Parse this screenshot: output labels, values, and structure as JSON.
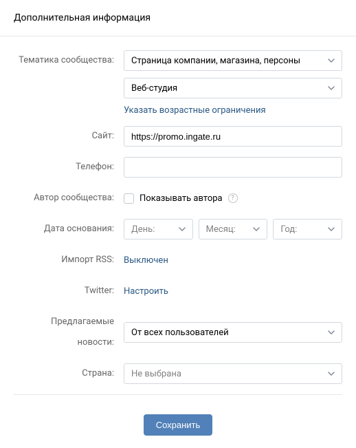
{
  "header": {
    "title": "Дополнительная информация"
  },
  "fields": {
    "topic": {
      "label": "Тематика сообщества:",
      "value": "Страница компании, магазина, персоны",
      "subvalue": "Веб-студия",
      "age_link": "Указать возрастные ограничения"
    },
    "site": {
      "label": "Сайт:",
      "value": "https://promo.ingate.ru"
    },
    "phone": {
      "label": "Телефон:",
      "value": ""
    },
    "author": {
      "label": "Автор сообщества:",
      "checkbox_label": "Показывать автора",
      "help": "?"
    },
    "foundation": {
      "label": "Дата основания:",
      "day": "День:",
      "month": "Месяц:",
      "year": "Год:"
    },
    "rss": {
      "label": "Импорт RSS:",
      "value": "Выключен"
    },
    "twitter": {
      "label": "Twitter:",
      "value": "Настроить"
    },
    "news": {
      "label": "Предлагаемые новости:",
      "value": "От всех пользователей"
    },
    "country": {
      "label": "Страна:",
      "value": "Не выбрана"
    }
  },
  "actions": {
    "save": "Сохранить"
  }
}
